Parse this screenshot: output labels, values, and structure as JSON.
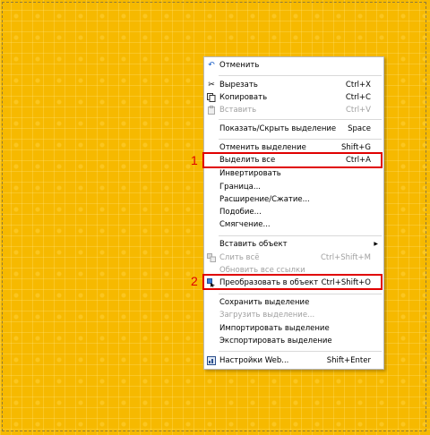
{
  "colors": {
    "background": "#f6b900",
    "highlight": "#e00000"
  },
  "menu": {
    "items": [
      {
        "label": "Отменить",
        "shortcut": "",
        "icon": "undo-icon",
        "disabled": false
      },
      {
        "label": "Вырезать",
        "shortcut": "Ctrl+X",
        "icon": "scissors-icon",
        "disabled": false
      },
      {
        "label": "Копировать",
        "shortcut": "Ctrl+C",
        "icon": "copy-icon",
        "disabled": false
      },
      {
        "label": "Вставить",
        "shortcut": "Ctrl+V",
        "icon": "paste-icon",
        "disabled": true
      },
      {
        "label": "Показать/Скрыть выделение",
        "shortcut": "Space",
        "disabled": false
      },
      {
        "label": "Отменить выделение",
        "shortcut": "Shift+G",
        "disabled": false
      },
      {
        "label": "Выделить все",
        "shortcut": "Ctrl+A",
        "disabled": false
      },
      {
        "label": "Инвертировать",
        "shortcut": "",
        "disabled": false
      },
      {
        "label": "Граница...",
        "shortcut": "",
        "disabled": false
      },
      {
        "label": "Расширение/Сжатие...",
        "shortcut": "",
        "disabled": false
      },
      {
        "label": "Подобие...",
        "shortcut": "",
        "disabled": false
      },
      {
        "label": "Смягчение...",
        "shortcut": "",
        "disabled": false
      },
      {
        "label": "Вставить объект",
        "shortcut": "",
        "submenu": true,
        "disabled": false
      },
      {
        "label": "Слить всё",
        "shortcut": "Ctrl+Shift+M",
        "icon": "merge-icon",
        "disabled": true
      },
      {
        "label": "Обновить все ссылки",
        "shortcut": "",
        "disabled": true
      },
      {
        "label": "Преобразовать в объект",
        "shortcut": "Ctrl+Shift+O",
        "icon": "convert-object-icon",
        "disabled": false
      },
      {
        "label": "Сохранить выделение",
        "shortcut": "",
        "disabled": false
      },
      {
        "label": "Загрузить выделение...",
        "shortcut": "",
        "disabled": true
      },
      {
        "label": "Импортировать выделение",
        "shortcut": "",
        "disabled": false
      },
      {
        "label": "Экспортировать выделение",
        "shortcut": "",
        "disabled": false
      },
      {
        "label": "Настройки Web...",
        "shortcut": "Shift+Enter",
        "icon": "web-settings-icon",
        "disabled": false
      }
    ]
  },
  "annotations": {
    "marker1": "1",
    "marker2": "2"
  }
}
